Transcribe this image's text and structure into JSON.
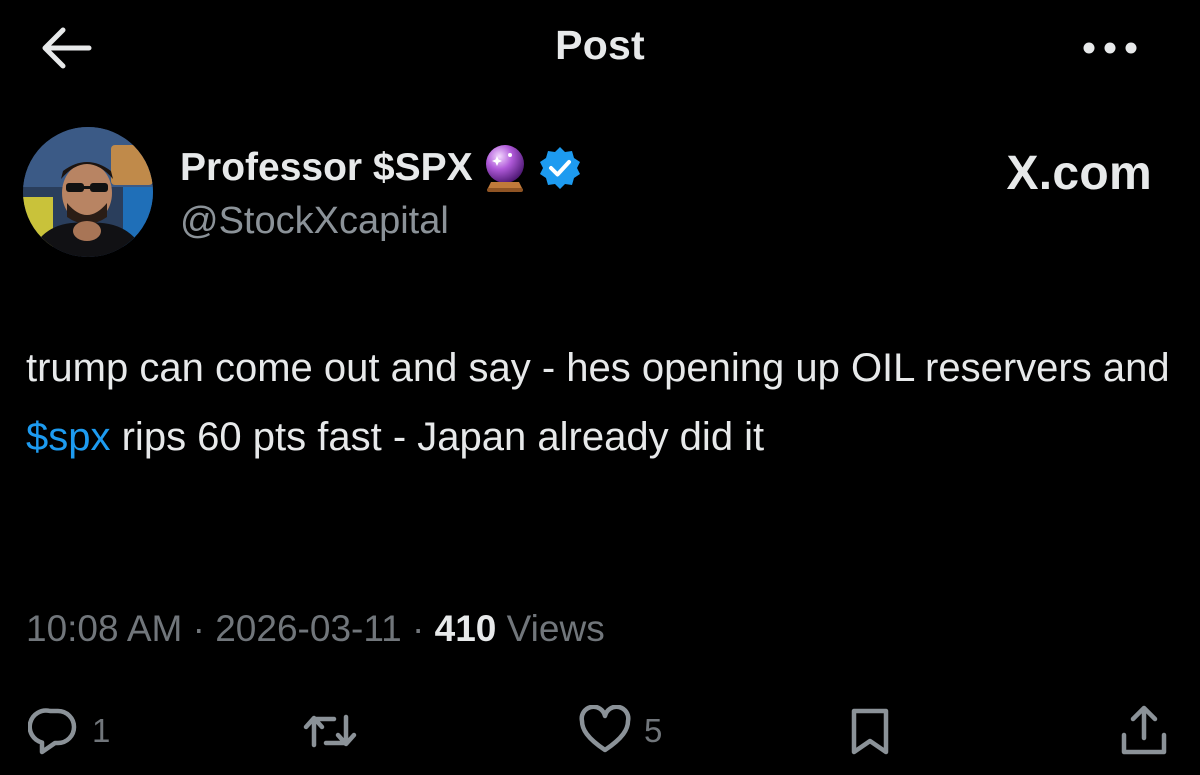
{
  "header": {
    "title": "Post",
    "back_icon": "arrow-left-icon",
    "more_icon": "more-horizontal-icon"
  },
  "author": {
    "name": "Professor $SPX",
    "handle": "@StockXcapital",
    "badges": [
      "crystal-ball-icon",
      "verified-badge-icon"
    ],
    "avatar": "avatar"
  },
  "source_mark": "X.com",
  "post": {
    "text_before": "trump can come out and say - hes opening up OIL reservers and ",
    "cashtag": "$spx",
    "text_after": " rips 60 pts fast - Japan already did it"
  },
  "meta": {
    "time": "10:08 AM",
    "separator": "·",
    "date": "2026-03-11",
    "views_count": "410",
    "views_label": "Views"
  },
  "actions": {
    "reply_count": "1",
    "repost_count": "",
    "like_count": "5"
  },
  "colors": {
    "background": "#000000",
    "text": "#e7e9ea",
    "secondary": "#71767b",
    "link": "#1d9bf0",
    "verified": "#1d9bf0"
  }
}
